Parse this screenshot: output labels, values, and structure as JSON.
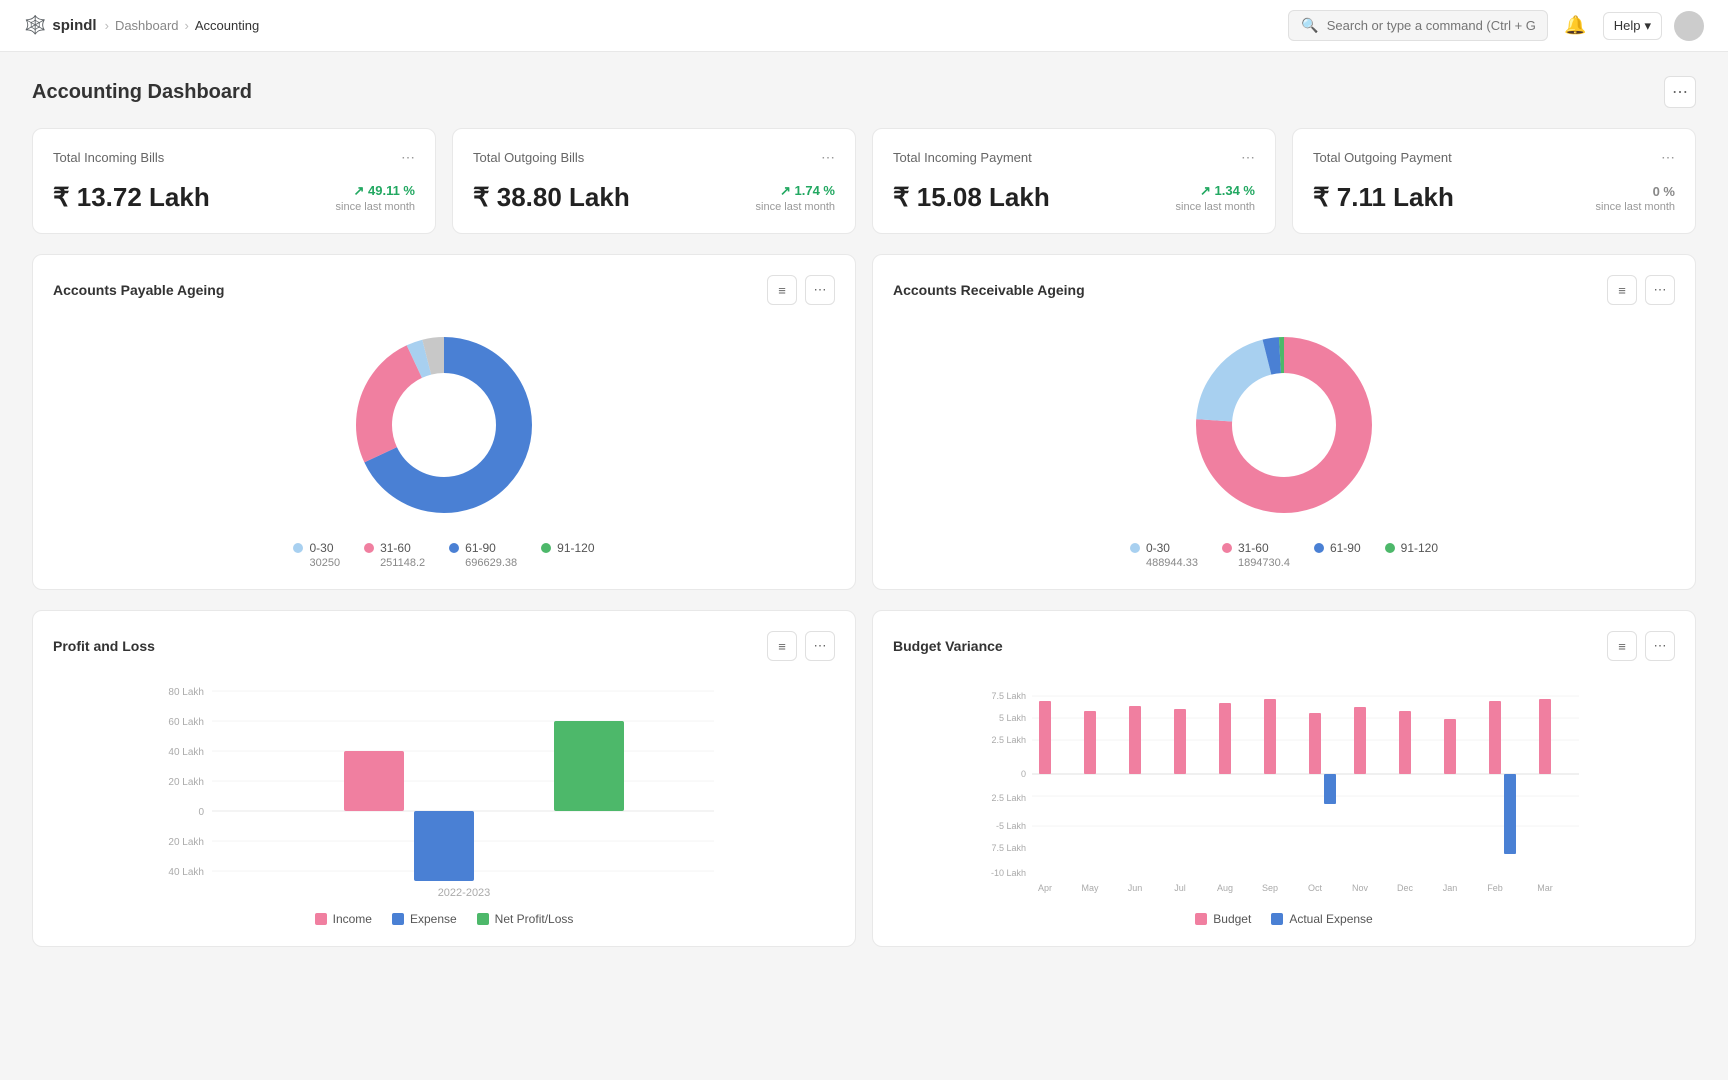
{
  "app": {
    "logo_text": "spindl",
    "breadcrumb": [
      "Dashboard",
      "Accounting"
    ],
    "search_placeholder": "Search or type a command (Ctrl + G)",
    "help_label": "Help",
    "page_title": "Accounting Dashboard"
  },
  "kpis": [
    {
      "id": "total-incoming-bills",
      "title": "Total Incoming Bills",
      "value": "₹ 13.72 Lakh",
      "pct": "49.11 %",
      "since": "since last month",
      "positive": true
    },
    {
      "id": "total-outgoing-bills",
      "title": "Total Outgoing Bills",
      "value": "₹ 38.80 Lakh",
      "pct": "1.74 %",
      "since": "since last month",
      "positive": true
    },
    {
      "id": "total-incoming-payment",
      "title": "Total Incoming Payment",
      "value": "₹ 15.08 Lakh",
      "pct": "1.34 %",
      "since": "since last month",
      "positive": true
    },
    {
      "id": "total-outgoing-payment",
      "title": "Total Outgoing Payment",
      "value": "₹ 7.11 Lakh",
      "pct": "0 %",
      "since": "since last month",
      "positive": false
    }
  ],
  "accounts_payable": {
    "title": "Accounts Payable Ageing",
    "segments": [
      {
        "label": "0-30",
        "value": 30250,
        "color": "#a8d0f0",
        "pct": 3
      },
      {
        "label": "31-60",
        "value": 251148.2,
        "color": "#f07fa0",
        "pct": 25
      },
      {
        "label": "61-90",
        "value": 696629.38,
        "color": "#4a80d4",
        "pct": 68
      },
      {
        "label": "91-120",
        "value": 0,
        "color": "#4db86a",
        "pct": 4
      }
    ]
  },
  "accounts_receivable": {
    "title": "Accounts Receivable Ageing",
    "segments": [
      {
        "label": "0-30",
        "value": 488944.33,
        "color": "#a8d0f0",
        "pct": 20
      },
      {
        "label": "31-60",
        "value": 1894730.4,
        "color": "#f07fa0",
        "pct": 76
      },
      {
        "label": "61-90",
        "value": 0,
        "color": "#4a80d4",
        "pct": 3
      },
      {
        "label": "91-120",
        "value": 0,
        "color": "#4db86a",
        "pct": 1
      }
    ]
  },
  "profit_loss": {
    "title": "Profit and Loss",
    "year_label": "2022-2023",
    "y_labels": [
      "80 Lakh",
      "60 Lakh",
      "40 Lakh",
      "20 Lakh",
      "0",
      "20 Lakh",
      "40 Lakh"
    ],
    "legend": [
      {
        "label": "Income",
        "color": "#f07fa0"
      },
      {
        "label": "Expense",
        "color": "#4a80d4"
      },
      {
        "label": "Net Profit/Loss",
        "color": "#4db86a"
      }
    ]
  },
  "budget_variance": {
    "title": "Budget Variance",
    "y_labels": [
      "7.5 Lakh",
      "5 Lakh",
      "2.5 Lakh",
      "0",
      "2.5 Lakh",
      "-5 Lakh",
      "7.5 Lakh",
      "-10 Lakh"
    ],
    "x_labels": [
      "Apr",
      "May",
      "Jun",
      "Jul",
      "Aug",
      "Sep",
      "Oct",
      "Nov",
      "Dec",
      "Jan",
      "Feb",
      "Mar"
    ],
    "legend": [
      {
        "label": "Budget",
        "color": "#f07fa0"
      },
      {
        "label": "Actual Expense",
        "color": "#4a80d4"
      }
    ]
  }
}
